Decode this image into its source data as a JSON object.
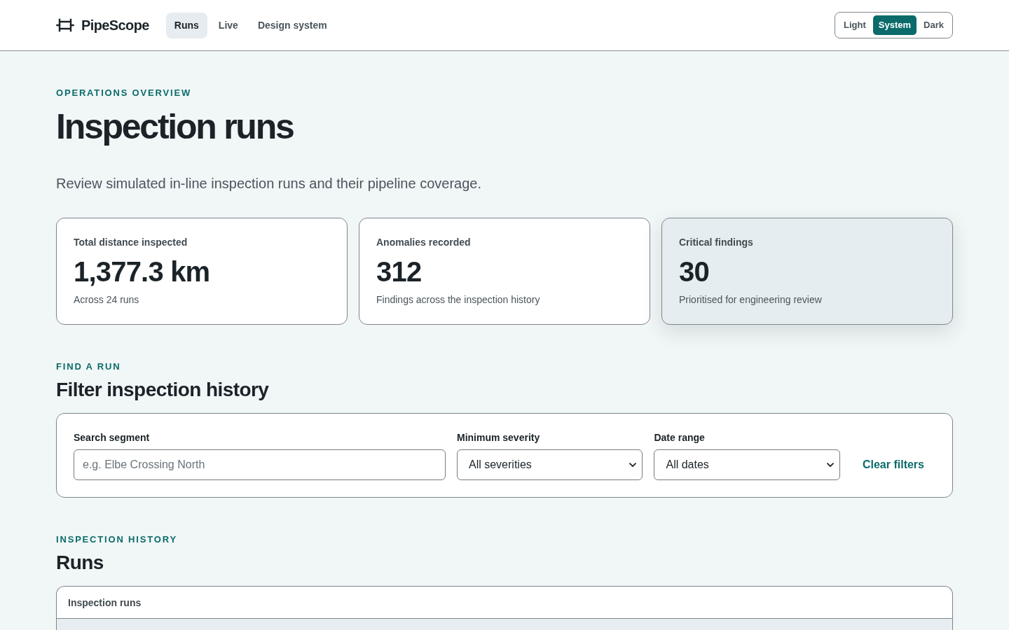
{
  "header": {
    "brand": "PipeScope",
    "nav": [
      {
        "label": "Runs",
        "selected": true
      },
      {
        "label": "Live",
        "selected": false
      },
      {
        "label": "Design system",
        "selected": false
      }
    ],
    "theme_options": [
      {
        "label": "Light",
        "selected": false
      },
      {
        "label": "System",
        "selected": true
      },
      {
        "label": "Dark",
        "selected": false
      }
    ]
  },
  "overview": {
    "eyebrow": "OPERATIONS OVERVIEW",
    "title": "Inspection runs",
    "description": "Review simulated in-line inspection runs and their pipeline coverage."
  },
  "stats": [
    {
      "label": "Total distance inspected",
      "value": "1,377.3 km",
      "note": "Across 24 runs",
      "emphasized": false
    },
    {
      "label": "Anomalies recorded",
      "value": "312",
      "note": "Findings across the inspection history",
      "emphasized": false
    },
    {
      "label": "Critical findings",
      "value": "30",
      "note": "Prioritised for engineering review",
      "emphasized": true
    }
  ],
  "filters": {
    "eyebrow": "FIND A RUN",
    "title": "Filter inspection history",
    "fields": [
      {
        "kind": "text",
        "label": "Search segment",
        "placeholder": "e.g. Elbe Crossing North"
      },
      {
        "kind": "select",
        "label": "Minimum severity",
        "value": "All severities"
      },
      {
        "kind": "select",
        "label": "Date range",
        "value": "All dates"
      }
    ],
    "clear_link": "Clear filters"
  },
  "history": {
    "eyebrow": "INSPECTION HISTORY",
    "title": "Runs",
    "table": {
      "caption": "Inspection runs"
    }
  }
}
